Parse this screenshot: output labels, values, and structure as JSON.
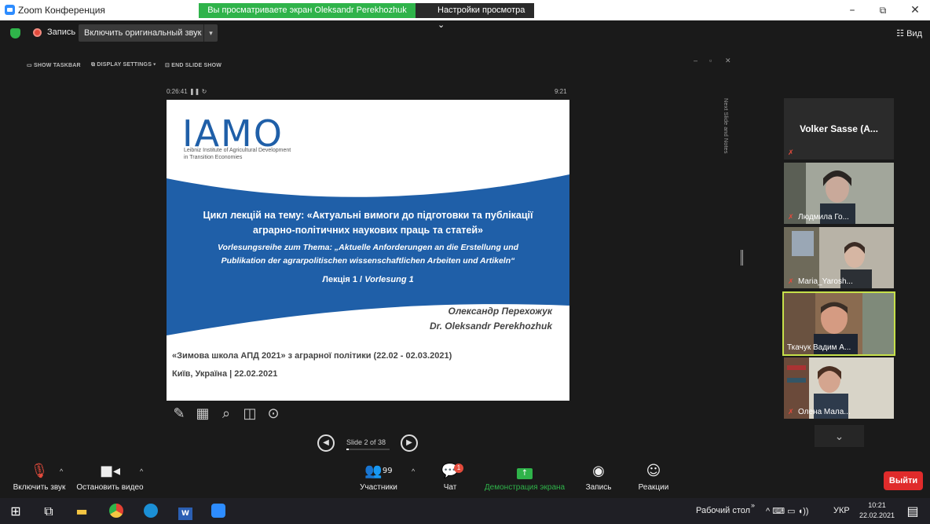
{
  "window": {
    "title": "Zoom Конференция",
    "share_banner": "Вы просматриваете экран Oleksandr Perekhozhuk",
    "view_settings": "Настройки просмотра",
    "min": "–",
    "restore": "⧉",
    "close": "✕"
  },
  "topbar": {
    "record_label": "Запись",
    "original_sound": "Включить оригинальный звук",
    "view_label": "Вид"
  },
  "slideshow": {
    "show_taskbar": "SHOW TASKBAR",
    "display_settings": "DISPLAY SETTINGS ▾",
    "end_slide_show": "END SLIDE SHOW",
    "timer": "0:26:41",
    "clock": "9:21",
    "next_notes": "Next Slide and Notes",
    "slide_counter": "Slide 2 of 38",
    "progress_fraction": 0.053
  },
  "slide": {
    "logo": "IAMO",
    "logo_sub1": "Leibniz Institute of Agricultural Development",
    "logo_sub2": "in Transition Economies",
    "line1a": "Цикл лекцій на тему: «Актуальні вимоги до підготовки та публікації",
    "line1b": "аграрно-політичних наукових праць та статей»",
    "line2a": "Vorlesungsreihe zum Thema: „Aktuelle Anforderungen an die Erstellung und",
    "line2b": "Publikation der agrarpolitischen wissenschaftlichen Arbeiten und Artikeln“",
    "lecture_uk": "Лекція 1 /",
    "lecture_de": "Vorlesung 1",
    "author_uk": "Олександр Перехожук",
    "author_en": "Dr. Oleksandr Perekhozhuk",
    "school": "«Зимова школа АПД 2021» з аграрної політики (22.02 - 02.03.2021)",
    "place_date": "Київ, Україна | 22.02.2021"
  },
  "participants": [
    {
      "name": "Volker Sasse (A...",
      "video": false
    },
    {
      "name": "Людмила Го...",
      "video": true
    },
    {
      "name": "Maria_Yarosh...",
      "video": true
    },
    {
      "name": "Ткачук Вадим А...",
      "video": true,
      "active": true
    },
    {
      "name": "Олена Мала...",
      "video": true
    }
  ],
  "toolbar": {
    "unmute": "Включить звук",
    "stop_video": "Остановить видео",
    "participants": "Участники",
    "participants_count": "99",
    "chat": "Чат",
    "chat_badge": "1",
    "share_screen": "Демонстрация экрана",
    "record": "Запись",
    "reactions": "Реакции",
    "leave": "Выйти"
  },
  "taskbar": {
    "desktop_label": "Рабочий стол",
    "lang": "УКР",
    "time": "10:21",
    "date": "22.02.2021"
  },
  "colors": {
    "zoom_blue": "#2d8cff",
    "share_green": "#2fb34a",
    "leave_red": "#e02b2b",
    "slide_blue": "#1f5fa8",
    "active_speaker": "#c6e04a"
  }
}
